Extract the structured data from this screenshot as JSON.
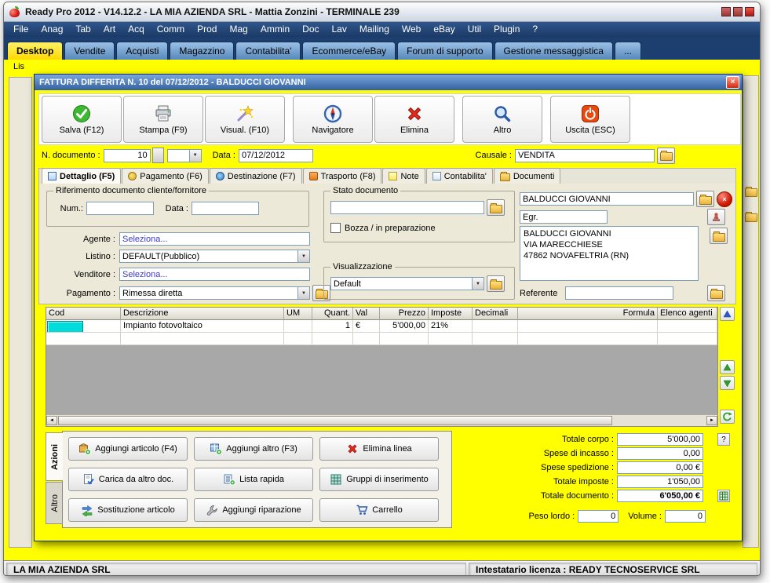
{
  "colors": {
    "accent_yellow": "#ffff00",
    "menubar_blue": "#1b3a66",
    "active_tab_yellow": "#ffd800",
    "dialog_title_blue": "#33609f",
    "selected_cell_cyan": "#00dcdc",
    "link_blue": "#3a3ac8",
    "close_red": "#d22a10"
  },
  "titlebar": {
    "title": "Ready Pro 2012 - V14.12.2 - LA MIA AZIENDA SRL - Mattia Zonzini - TERMINALE 239"
  },
  "menubar": {
    "items": [
      "File",
      "Anag",
      "Tab",
      "Art",
      "Acq",
      "Comm",
      "Prod",
      "Mag",
      "Ammin",
      "Doc",
      "Lav",
      "Mailing",
      "Web",
      "eBay",
      "Util",
      "Plugin",
      "?"
    ]
  },
  "tabbar": {
    "items": [
      "Desktop",
      "Vendite",
      "Acquisti",
      "Magazzino",
      "Contabilita'",
      "Ecommerce/eBay",
      "Forum di supporto",
      "Gestione messaggistica",
      "..."
    ],
    "active": "Desktop"
  },
  "background": {
    "top_left_fragment": "Lis"
  },
  "dialog": {
    "title": "FATTURA DIFFERITA N. 10  del 07/12/2012 - BALDUCCI GIOVANNI",
    "close_glyph": "×",
    "toolbar": {
      "salva": "Salva (F12)",
      "stampa": "Stampa (F9)",
      "visual": "Visual. (F10)",
      "navigatore": "Navigatore",
      "elimina": "Elimina",
      "altro": "Altro",
      "uscita": "Uscita (ESC)"
    },
    "doc_row": {
      "n_documento_label": "N. documento :",
      "n_documento": "10",
      "tipo": "",
      "data_label": "Data :",
      "data": "07/12/2012",
      "causale_label": "Causale :",
      "causale": "VENDITA"
    },
    "form_tabs": [
      "Dettaglio (F5)",
      "Pagamento (F6)",
      "Destinazione (F7)",
      "Trasporto (F8)",
      "Note",
      "Contabilita'",
      "Documenti"
    ],
    "riferimento": {
      "title": "Riferimento documento cliente/fornitore",
      "num_label": "Num.:",
      "num": "",
      "data_label": "Data :",
      "data": ""
    },
    "left_fields": {
      "agente_label": "Agente :",
      "agente": "Seleziona...",
      "listino_label": "Listino :",
      "listino": "DEFAULT(Pubblico)",
      "venditore_label": "Venditore :",
      "venditore": "Seleziona...",
      "pagamento_label": "Pagamento :",
      "pagamento": "Rimessa diretta"
    },
    "stato": {
      "title": "Stato documento",
      "value": "",
      "bozza_label": "Bozza / in preparazione"
    },
    "visualizzazione": {
      "title": "Visualizzazione",
      "value": "Default"
    },
    "cliente": {
      "nome": "BALDUCCI GIOVANNI",
      "titolo": "Egr.",
      "indirizzo": [
        "BALDUCCI GIOVANNI",
        "VIA MARECCHIESE",
        "47862 NOVAFELTRIA (RN)"
      ],
      "referente_label": "Referente",
      "referente": ""
    },
    "grid": {
      "headers": [
        "Cod",
        "Descrizione",
        "UM",
        "Quant.",
        "Val",
        "Prezzo",
        "Imposte",
        "Decimali",
        "Formula",
        "Elenco agenti"
      ],
      "rows": [
        {
          "cod": "",
          "descrizione": "Impianto fotovoltaico",
          "um": "",
          "quant": "1",
          "val": "€",
          "prezzo": "5'000,00",
          "imposte": "21%",
          "decimali": "",
          "formula": "",
          "elenco_agenti": ""
        }
      ]
    },
    "azioni": {
      "tabs": [
        "Azioni",
        "Altro"
      ],
      "buttons": [
        "Aggiungi articolo (F4)",
        "Aggiungi altro (F3)",
        "Elimina linea",
        "Carica da altro doc.",
        "Lista rapida",
        "Gruppi di inserimento",
        "Sostituzione articolo",
        "Aggiungi riparazione",
        "Carrello"
      ]
    },
    "totali": {
      "totale_corpo_label": "Totale corpo :",
      "totale_corpo": "5'000,00",
      "spese_incasso_label": "Spese di incasso :",
      "spese_incasso": "0,00",
      "spese_spedizione_label": "Spese spedizione :",
      "spese_spedizione": "0,00 €",
      "totale_imposte_label": "Totale imposte :",
      "totale_imposte": "1'050,00",
      "totale_documento_label": "Totale documento :",
      "totale_documento": "6'050,00 €",
      "peso_lordo_label": "Peso lordo :",
      "peso_lordo": "0",
      "volume_label": "Volume :",
      "volume": "0",
      "help_button": "?"
    }
  },
  "statusbar": {
    "left": "LA MIA AZIENDA SRL",
    "right": "Intestatario licenza : READY TECNOSERVICE SRL"
  }
}
